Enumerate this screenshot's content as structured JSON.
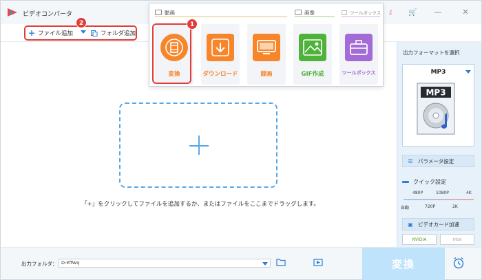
{
  "app": {
    "title": "ビデオコンバータ"
  },
  "toolbar": {
    "add_file_label": "ファイル追加",
    "add_folder_label": "フォルダ追加",
    "step2_badge": "2"
  },
  "popup": {
    "sections": {
      "video": "動画",
      "image": "画像",
      "toolbox": "ツールボックス"
    },
    "tiles": [
      {
        "label": "変換",
        "icon": "film-icon",
        "color": "#f7862a"
      },
      {
        "label": "ダウンロード",
        "icon": "download-icon",
        "color": "#f7862a"
      },
      {
        "label": "録画",
        "icon": "screen-record-icon",
        "color": "#f7862a"
      },
      {
        "label": "GIF作成",
        "icon": "image-icon",
        "color": "#4fb23a"
      },
      {
        "label": "ツールボックス",
        "icon": "toolbox-icon",
        "color": "#a46ad6"
      }
    ],
    "step1_badge": "1"
  },
  "main": {
    "drop_hint": "「+」をクリックしてファイルを追加するか、またはファイルをここまでドラッグします。"
  },
  "right_panel": {
    "title": "出力フォーマットを選択",
    "format_name": "MP3",
    "format_icon_text": "MP3",
    "param_label": "パラメータ設定",
    "quick_title": "クイック設定",
    "quick_top_labels": [
      "480P",
      "1080P",
      "4K"
    ],
    "quick_bottom_labels": [
      "自動",
      "720P",
      "2K"
    ],
    "gpu_label": "ビデオカード加速",
    "gpu_nvidia": "NVIDIA",
    "gpu_intel": "Intel"
  },
  "bottom": {
    "output_label": "出力フォルダ：",
    "output_path": "D:¥ffWq",
    "convert_label": "変換"
  },
  "colors": {
    "accent": "#2a7fd4",
    "highlight": "#e23b3b",
    "orange": "#f7862a",
    "green": "#4fb23a",
    "purple": "#a46ad6"
  }
}
